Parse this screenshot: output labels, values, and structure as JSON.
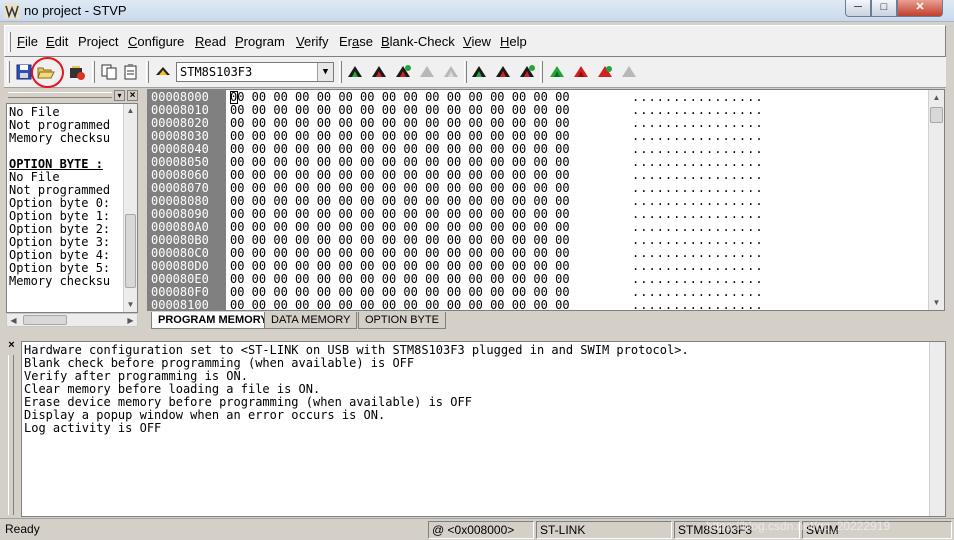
{
  "window": {
    "title": "no project - STVP",
    "controls": {
      "minimize": "─",
      "maximize": "□",
      "close": "✕"
    }
  },
  "menu": [
    {
      "label": "File",
      "accel": "F"
    },
    {
      "label": "Edit",
      "accel": "E"
    },
    {
      "label": "Project",
      "accel": "j"
    },
    {
      "label": "Configure",
      "accel": "C"
    },
    {
      "label": "Read",
      "accel": "R"
    },
    {
      "label": "Program",
      "accel": "P"
    },
    {
      "label": "Verify",
      "accel": "V"
    },
    {
      "label": "Erase",
      "accel": "a"
    },
    {
      "label": "Blank-Check",
      "accel": "B"
    },
    {
      "label": "View",
      "accel": "V"
    },
    {
      "label": "Help",
      "accel": "H"
    }
  ],
  "toolbar": {
    "device": "STM8S103F3",
    "icons": [
      "save-icon",
      "open-icon",
      "open-project-icon",
      "copy-icon",
      "paste-icon",
      "chip-icon",
      "read-all-icon",
      "program-all-icon",
      "verify-all-icon",
      "erase-all-icon",
      "blank-check-all-icon",
      "read-current-icon",
      "program-current-icon",
      "verify-current-icon",
      "read-option-icon",
      "program-option-icon",
      "verify-option-icon",
      "erase-option-icon"
    ]
  },
  "info_panel": {
    "lines": [
      {
        "text": "No File",
        "bold": false
      },
      {
        "text": "Not programmed",
        "bold": false
      },
      {
        "text": "Memory checksu",
        "bold": false
      },
      {
        "text": "",
        "bold": false
      },
      {
        "text": "OPTION BYTE :",
        "bold": true
      },
      {
        "text": "No File",
        "bold": false
      },
      {
        "text": "Not programmed",
        "bold": false
      },
      {
        "text": "Option byte 0:",
        "bold": false
      },
      {
        "text": "Option byte 1:",
        "bold": false
      },
      {
        "text": "Option byte 2:",
        "bold": false
      },
      {
        "text": "Option byte 3:",
        "bold": false
      },
      {
        "text": "Option byte 4:",
        "bold": false
      },
      {
        "text": "Option byte 5:",
        "bold": false
      },
      {
        "text": "Memory checksu",
        "bold": false
      }
    ]
  },
  "memory": {
    "addresses": [
      "00008000",
      "00008010",
      "00008020",
      "00008030",
      "00008040",
      "00008050",
      "00008060",
      "00008070",
      "00008080",
      "00008090",
      "000080A0",
      "000080B0",
      "000080C0",
      "000080D0",
      "000080E0",
      "000080F0",
      "00008100"
    ],
    "hex_row": "00 00 00 00 00 00 00 00 00 00 00 00 00 00 00 00",
    "ascii_row": "................"
  },
  "tabs": [
    "PROGRAM MEMORY",
    "DATA MEMORY",
    "OPTION BYTE"
  ],
  "log": [
    "Hardware configuration set to <ST-LINK on USB with STM8S103F3 plugged in and SWIM protocol>.",
    "Blank check before programming (when available) is OFF",
    "Verify after programming is ON.",
    "Clear memory before loading a file is ON.",
    "Erase device memory before programming (when available) is OFF",
    "Display a popup window when an error occurs is ON.",
    "Log activity is OFF"
  ],
  "status": {
    "state": "Ready",
    "address": "@ <0x008000>",
    "tool": "ST-LINK",
    "device": "STM8S103F3",
    "protocol": "SWIM",
    "watermark": "https://blog.csdn.net/qq_20222919"
  }
}
